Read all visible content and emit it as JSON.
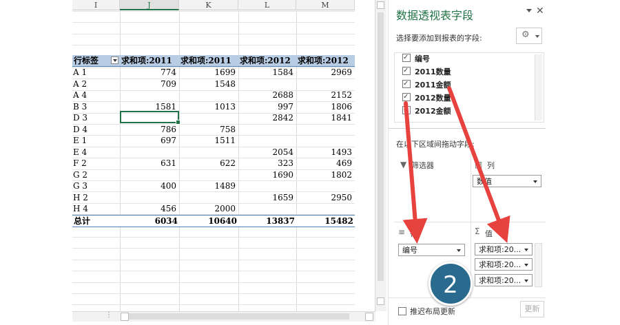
{
  "sheet": {
    "columns": [
      "I",
      "J",
      "K",
      "L",
      "M"
    ],
    "selected_column": "J",
    "pivot_header": {
      "row_label": "行标签",
      "cols": [
        "求和项:2011",
        "求和项:2011",
        "求和项:2012",
        "求和项:2012"
      ]
    },
    "rows": [
      {
        "label": "A 1",
        "v": [
          "774",
          "1699",
          "1584",
          "2969"
        ]
      },
      {
        "label": "A 2",
        "v": [
          "709",
          "1548",
          "",
          ""
        ]
      },
      {
        "label": "A 4",
        "v": [
          "",
          "",
          "2688",
          "2152"
        ]
      },
      {
        "label": "B 3",
        "v": [
          "1581",
          "1013",
          "997",
          "1806"
        ]
      },
      {
        "label": "D 3",
        "v": [
          "",
          "",
          "2842",
          "1841"
        ]
      },
      {
        "label": "D 4",
        "v": [
          "786",
          "758",
          "",
          ""
        ]
      },
      {
        "label": "E 1",
        "v": [
          "697",
          "1511",
          "",
          ""
        ]
      },
      {
        "label": "E 4",
        "v": [
          "",
          "",
          "2054",
          "1493"
        ]
      },
      {
        "label": "F 2",
        "v": [
          "631",
          "622",
          "323",
          "469"
        ]
      },
      {
        "label": "G 2",
        "v": [
          "",
          "",
          "1690",
          "1802"
        ]
      },
      {
        "label": "G 3",
        "v": [
          "400",
          "1489",
          "",
          ""
        ]
      },
      {
        "label": "H 2",
        "v": [
          "",
          "",
          "1659",
          "2950"
        ]
      },
      {
        "label": "H 4",
        "v": [
          "456",
          "2000",
          "",
          ""
        ]
      }
    ],
    "total": {
      "label": "总计",
      "v": [
        "6034",
        "10640",
        "13837",
        "15482"
      ]
    }
  },
  "panel": {
    "title": "数据透视表字段",
    "choose_fields": "选择要添加到报表的字段:",
    "fields": [
      {
        "name": "编号",
        "checked": true
      },
      {
        "name": "2011数量",
        "checked": true
      },
      {
        "name": "2011金额",
        "checked": true
      },
      {
        "name": "2012数量",
        "checked": true
      },
      {
        "name": "2012金额",
        "checked": true
      }
    ],
    "drag_hint": "在以下区域间拖动字段:",
    "zones": {
      "filters": "筛选器",
      "columns": "列",
      "rows": "行",
      "values": "值"
    },
    "columns_item": "数值",
    "rows_item": "编号",
    "values_items": [
      "求和项:20...",
      "求和项:20...",
      "求和项:20..."
    ],
    "defer_label": "推迟布局更新",
    "update_button": "更新",
    "step_badge": "2",
    "arrow_color": "#e8423f",
    "badge_color": "#2a6a8e"
  }
}
